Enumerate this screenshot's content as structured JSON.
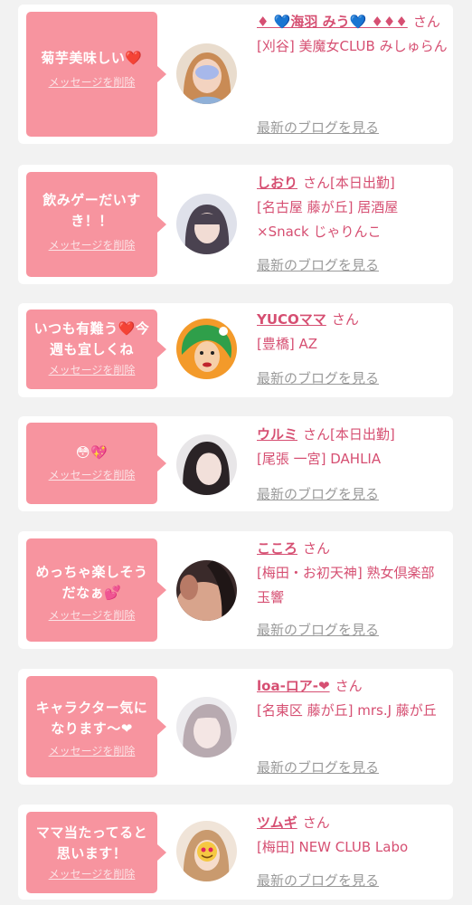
{
  "delete_label": "メッセージを削除",
  "blog_label": "最新のブログを見る",
  "san": "さん",
  "items": [
    {
      "message": "菊芋美味しい❤️",
      "name": "♦ 💙海羽 みう💙 ♦♦♦",
      "status": "",
      "shop": "[刈谷] 美魔女CLUB みしゅらん"
    },
    {
      "message": "飲みゲーだいすき！！",
      "name": "しおり",
      "status": "[本日出勤]",
      "shop": "[名古屋 藤が丘] 居酒屋×Snack じゃりんこ"
    },
    {
      "message": "いつも有難う❤️今週も宜しくね",
      "name": "YUCOママ",
      "status": "",
      "shop": "[豊橋] AZ"
    },
    {
      "message": "😳💖",
      "name": "ウルミ",
      "status": "[本日出勤]",
      "shop": "[尾張 一宮] DAHLIA"
    },
    {
      "message": "めっちゃ楽しそうだなぁ💕",
      "name": "こころ",
      "status": "",
      "shop": "[梅田・お初天神] 熟女倶楽部 玉響"
    },
    {
      "message": "キャラクター気になります〜❤",
      "name": "loa-ロア-❤",
      "status": "",
      "shop": "[名東区 藤が丘] mrs.J 藤が丘"
    },
    {
      "message": "ママ当たってると思います！",
      "name": "ツムギ",
      "status": "",
      "shop": "[梅田] NEW CLUB Labo"
    }
  ]
}
